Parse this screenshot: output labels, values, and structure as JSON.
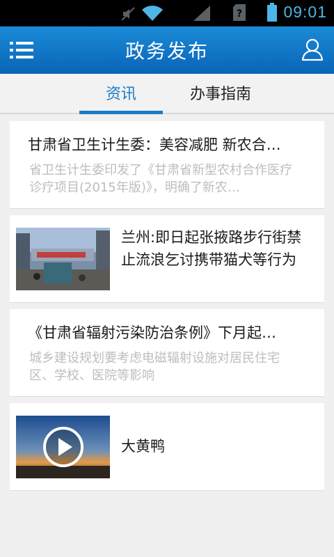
{
  "status_bar": {
    "time": "09:01",
    "icons": [
      "mute-icon",
      "wifi-icon",
      "signal-icon",
      "sim-unknown-icon",
      "battery-icon"
    ]
  },
  "app_bar": {
    "title": "政务发布",
    "left_icon": "menu-icon",
    "right_icon": "user-icon"
  },
  "tabs": [
    {
      "label": "资讯",
      "active": true
    },
    {
      "label": "办事指南",
      "active": false
    }
  ],
  "news": [
    {
      "type": "text",
      "title": "甘肃省卫生计生委：美容减肥 新农合…",
      "summary": "省卫生计生委印发了《甘肃省新型农村合作医疗诊疗项目(2015年版)》，明确了新农…"
    },
    {
      "type": "image",
      "title": "兰州:即日起张掖路步行街禁止流浪乞讨携带猫犬等行为",
      "image": "street-photo"
    },
    {
      "type": "text",
      "title": "《甘肃省辐射污染防治条例》下月起…",
      "summary": "城乡建设规划要考虑电磁辐射设施对居民住宅区、学校、医院等影响"
    },
    {
      "type": "video",
      "title": "大黄鸭",
      "image": "sunset-video-thumbnail"
    }
  ],
  "colors": {
    "accent": "#1a7cc9",
    "appbar_top": "#1a8bd8",
    "appbar_bottom": "#0a64b6",
    "status_icon": "#4fb4e8"
  }
}
